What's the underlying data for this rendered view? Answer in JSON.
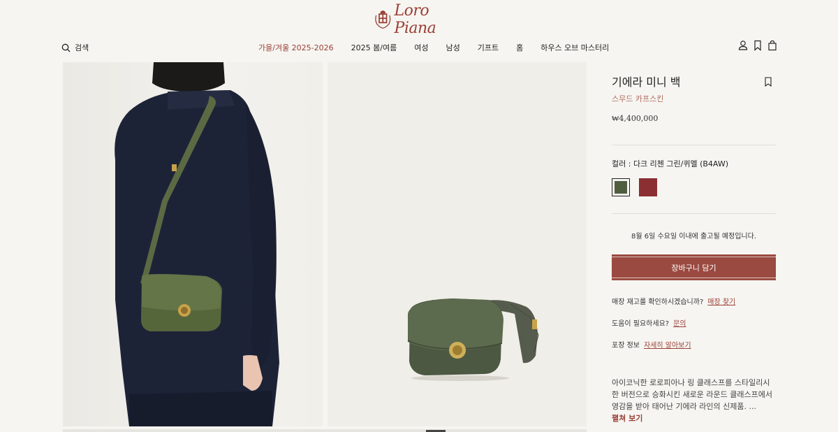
{
  "header": {
    "logo_text": "Loro Piana",
    "search_label": "검색",
    "nav": [
      {
        "label": "가을/겨울 2025-2026",
        "active": true
      },
      {
        "label": "2025 봄/여름"
      },
      {
        "label": "여성"
      },
      {
        "label": "남성"
      },
      {
        "label": "기프트"
      },
      {
        "label": "홈"
      },
      {
        "label": "하우스 오브 마스터리"
      }
    ],
    "icons": [
      "user-icon",
      "bookmark-icon",
      "bag-icon"
    ]
  },
  "colors": {
    "brand": "#9a3f35",
    "cart_button": "#9a4a40",
    "swatch_green": "#4f5e3f",
    "swatch_red": "#8b2f32"
  },
  "product": {
    "title": "기에라 미니 백",
    "subtitle": "스무드 카프스킨",
    "price": "₩4,400,000",
    "color_label": "컬러 : 다크 리첸 그린/퀴멜 (B4AW)",
    "swatches": [
      {
        "name": "dark-lichen-green",
        "color": "#4f5e3f",
        "selected": true
      },
      {
        "name": "red",
        "color": "#8b2f32",
        "selected": false
      }
    ],
    "shipping": "8월 6일 수요일 이내에 출고될 예정입니다.",
    "cart_label": "장바구니 담기",
    "stock_text": "매장 재고를 확인하시겠습니까?",
    "stock_link": "매장 찾기",
    "help_text": "도움이 필요하세요?",
    "help_link": "문의",
    "packaging_text": "포장 정보",
    "packaging_link": "자세히 알아보기",
    "description": "아이코닉한 로로피아나 링 클래스프를 스타일리시한 버전으로 승화시킨 새로운 라운드 클래스프에서 영감을 받아 태어난 기에라 라인의 신제품. ...",
    "more_label": "펼쳐 보기"
  }
}
